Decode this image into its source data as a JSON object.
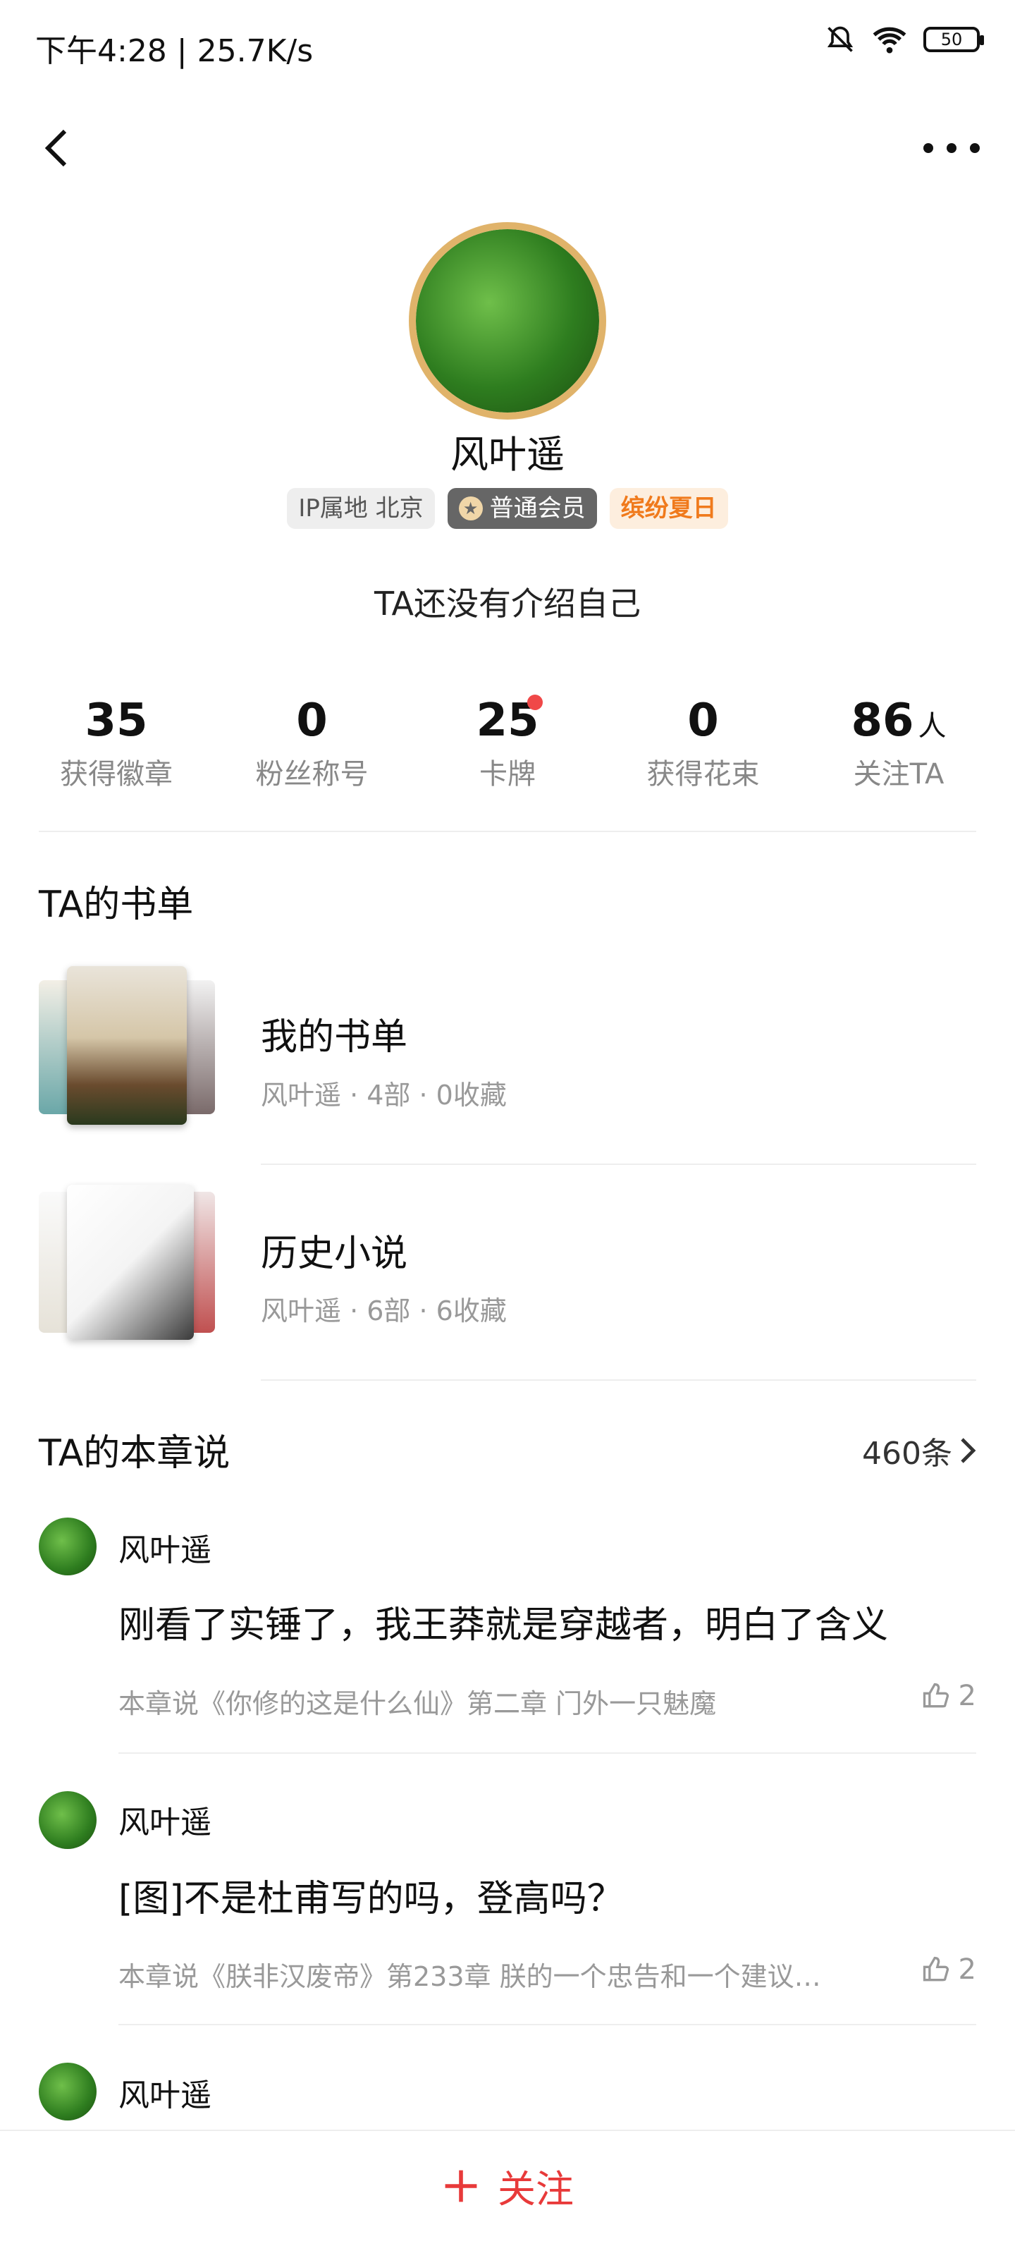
{
  "status_bar": {
    "time": "下午4:28 | 25.7K/s",
    "battery": "50",
    "icons": [
      "mute-icon",
      "wifi-icon",
      "battery-icon"
    ]
  },
  "header": {
    "back_icon": "chevron-left-icon",
    "more_icon": "more-icon"
  },
  "profile": {
    "name": "风叶遥",
    "tags": {
      "ip": "IP属地 北京",
      "vip": "普通会员",
      "event": "缤纷夏日"
    },
    "bio": "TA还没有介绍自己"
  },
  "stats": [
    {
      "value": "35",
      "unit": "",
      "label": "获得徽章"
    },
    {
      "value": "0",
      "unit": "",
      "label": "粉丝称号"
    },
    {
      "value": "25",
      "unit": "",
      "label": "卡牌"
    },
    {
      "value": "0",
      "unit": "",
      "label": "获得花束"
    },
    {
      "value": "86",
      "unit": "人",
      "label": "关注TA"
    }
  ],
  "booklists": {
    "title": "TA的书单",
    "items": [
      {
        "title": "我的书单",
        "meta": "风叶遥 · 4部 · 0收藏"
      },
      {
        "title": "历史小说",
        "meta": "风叶遥 · 6部 · 6收藏"
      }
    ]
  },
  "comments": {
    "title": "TA的本章说",
    "count": "460条",
    "items": [
      {
        "name": "风叶遥",
        "text": "刚看了实锤了，我王莽就是穿越者，明白了含义",
        "source": "本章说《你修的这是什么仙》第二章 门外一只魅魔",
        "likes": "2"
      },
      {
        "name": "风叶遥",
        "text": "[图]不是杜甫写的吗，登高吗？",
        "source": "本章说《朕非汉废帝》第233章 朕的一个忠告和一个建议…",
        "likes": "2"
      },
      {
        "name": "风叶遥"
      }
    ]
  },
  "bottom": {
    "follow_label": "关注"
  },
  "colors": {
    "accent": "#e83a3a",
    "event_tag": "#f07a1c",
    "muted": "#999999"
  }
}
